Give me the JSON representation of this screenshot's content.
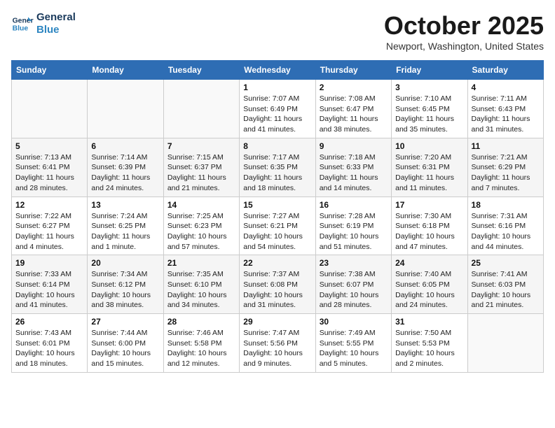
{
  "header": {
    "logo_line1": "General",
    "logo_line2": "Blue",
    "month": "October 2025",
    "location": "Newport, Washington, United States"
  },
  "days_of_week": [
    "Sunday",
    "Monday",
    "Tuesday",
    "Wednesday",
    "Thursday",
    "Friday",
    "Saturday"
  ],
  "weeks": [
    [
      {
        "day": "",
        "info": ""
      },
      {
        "day": "",
        "info": ""
      },
      {
        "day": "",
        "info": ""
      },
      {
        "day": "1",
        "info": "Sunrise: 7:07 AM\nSunset: 6:49 PM\nDaylight: 11 hours and 41 minutes."
      },
      {
        "day": "2",
        "info": "Sunrise: 7:08 AM\nSunset: 6:47 PM\nDaylight: 11 hours and 38 minutes."
      },
      {
        "day": "3",
        "info": "Sunrise: 7:10 AM\nSunset: 6:45 PM\nDaylight: 11 hours and 35 minutes."
      },
      {
        "day": "4",
        "info": "Sunrise: 7:11 AM\nSunset: 6:43 PM\nDaylight: 11 hours and 31 minutes."
      }
    ],
    [
      {
        "day": "5",
        "info": "Sunrise: 7:13 AM\nSunset: 6:41 PM\nDaylight: 11 hours and 28 minutes."
      },
      {
        "day": "6",
        "info": "Sunrise: 7:14 AM\nSunset: 6:39 PM\nDaylight: 11 hours and 24 minutes."
      },
      {
        "day": "7",
        "info": "Sunrise: 7:15 AM\nSunset: 6:37 PM\nDaylight: 11 hours and 21 minutes."
      },
      {
        "day": "8",
        "info": "Sunrise: 7:17 AM\nSunset: 6:35 PM\nDaylight: 11 hours and 18 minutes."
      },
      {
        "day": "9",
        "info": "Sunrise: 7:18 AM\nSunset: 6:33 PM\nDaylight: 11 hours and 14 minutes."
      },
      {
        "day": "10",
        "info": "Sunrise: 7:20 AM\nSunset: 6:31 PM\nDaylight: 11 hours and 11 minutes."
      },
      {
        "day": "11",
        "info": "Sunrise: 7:21 AM\nSunset: 6:29 PM\nDaylight: 11 hours and 7 minutes."
      }
    ],
    [
      {
        "day": "12",
        "info": "Sunrise: 7:22 AM\nSunset: 6:27 PM\nDaylight: 11 hours and 4 minutes."
      },
      {
        "day": "13",
        "info": "Sunrise: 7:24 AM\nSunset: 6:25 PM\nDaylight: 11 hours and 1 minute."
      },
      {
        "day": "14",
        "info": "Sunrise: 7:25 AM\nSunset: 6:23 PM\nDaylight: 10 hours and 57 minutes."
      },
      {
        "day": "15",
        "info": "Sunrise: 7:27 AM\nSunset: 6:21 PM\nDaylight: 10 hours and 54 minutes."
      },
      {
        "day": "16",
        "info": "Sunrise: 7:28 AM\nSunset: 6:19 PM\nDaylight: 10 hours and 51 minutes."
      },
      {
        "day": "17",
        "info": "Sunrise: 7:30 AM\nSunset: 6:18 PM\nDaylight: 10 hours and 47 minutes."
      },
      {
        "day": "18",
        "info": "Sunrise: 7:31 AM\nSunset: 6:16 PM\nDaylight: 10 hours and 44 minutes."
      }
    ],
    [
      {
        "day": "19",
        "info": "Sunrise: 7:33 AM\nSunset: 6:14 PM\nDaylight: 10 hours and 41 minutes."
      },
      {
        "day": "20",
        "info": "Sunrise: 7:34 AM\nSunset: 6:12 PM\nDaylight: 10 hours and 38 minutes."
      },
      {
        "day": "21",
        "info": "Sunrise: 7:35 AM\nSunset: 6:10 PM\nDaylight: 10 hours and 34 minutes."
      },
      {
        "day": "22",
        "info": "Sunrise: 7:37 AM\nSunset: 6:08 PM\nDaylight: 10 hours and 31 minutes."
      },
      {
        "day": "23",
        "info": "Sunrise: 7:38 AM\nSunset: 6:07 PM\nDaylight: 10 hours and 28 minutes."
      },
      {
        "day": "24",
        "info": "Sunrise: 7:40 AM\nSunset: 6:05 PM\nDaylight: 10 hours and 24 minutes."
      },
      {
        "day": "25",
        "info": "Sunrise: 7:41 AM\nSunset: 6:03 PM\nDaylight: 10 hours and 21 minutes."
      }
    ],
    [
      {
        "day": "26",
        "info": "Sunrise: 7:43 AM\nSunset: 6:01 PM\nDaylight: 10 hours and 18 minutes."
      },
      {
        "day": "27",
        "info": "Sunrise: 7:44 AM\nSunset: 6:00 PM\nDaylight: 10 hours and 15 minutes."
      },
      {
        "day": "28",
        "info": "Sunrise: 7:46 AM\nSunset: 5:58 PM\nDaylight: 10 hours and 12 minutes."
      },
      {
        "day": "29",
        "info": "Sunrise: 7:47 AM\nSunset: 5:56 PM\nDaylight: 10 hours and 9 minutes."
      },
      {
        "day": "30",
        "info": "Sunrise: 7:49 AM\nSunset: 5:55 PM\nDaylight: 10 hours and 5 minutes."
      },
      {
        "day": "31",
        "info": "Sunrise: 7:50 AM\nSunset: 5:53 PM\nDaylight: 10 hours and 2 minutes."
      },
      {
        "day": "",
        "info": ""
      }
    ]
  ]
}
